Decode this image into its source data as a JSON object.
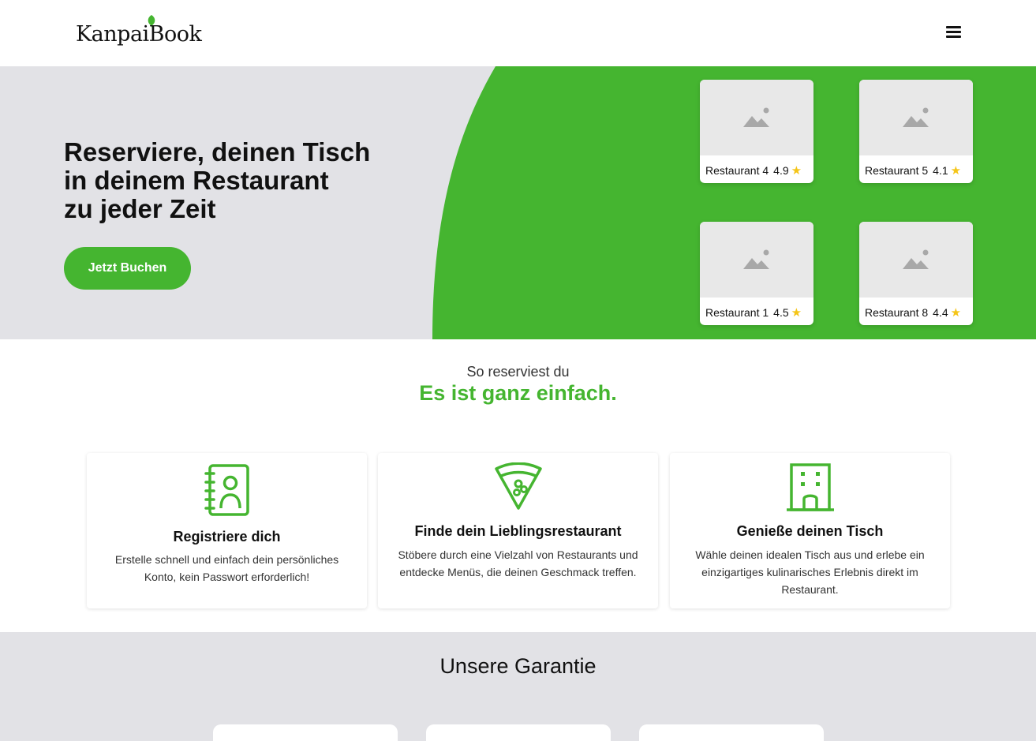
{
  "header": {
    "logo_text": "KanpaiBook",
    "menu_icon": "hamburger-menu-icon"
  },
  "hero": {
    "title_lines": [
      "Reserviere, deinen Tisch",
      "in deinem Restaurant",
      "zu jeder Zeit"
    ],
    "cta_label": "Jetzt Buchen",
    "restaurants": [
      {
        "name": "Restaurant 4",
        "rating": "4.9"
      },
      {
        "name": "Restaurant 5",
        "rating": "4.1"
      },
      {
        "name": "Restaurant 1",
        "rating": "4.5"
      },
      {
        "name": "Restaurant 8",
        "rating": "4.4"
      }
    ]
  },
  "how": {
    "subtitle": "So reserviest du",
    "title": "Es ist ganz einfach.",
    "steps": [
      {
        "title": "Registriere dich",
        "text": "Erstelle schnell und einfach dein persönliches Konto, kein Passwort erforderlich!",
        "icon": "contact-book-icon"
      },
      {
        "title": "Finde dein Lieblingsrestaurant",
        "text": "Stöbere durch eine Vielzahl von Restaurants und entdecke Menüs, die deinen Geschmack treffen.",
        "icon": "pizza-slice-icon"
      },
      {
        "title": "Genieße deinen Tisch",
        "text": "Wähle deinen idealen Tisch aus und erlebe ein einzigartiges kulinarisches Erlebnis direkt im Restaurant.",
        "icon": "building-icon"
      }
    ]
  },
  "guarantee": {
    "title": "Unsere Garantie"
  },
  "colors": {
    "brand_green": "#45b530",
    "hero_gray": "#e2e2e6",
    "star": "#f5c518"
  }
}
